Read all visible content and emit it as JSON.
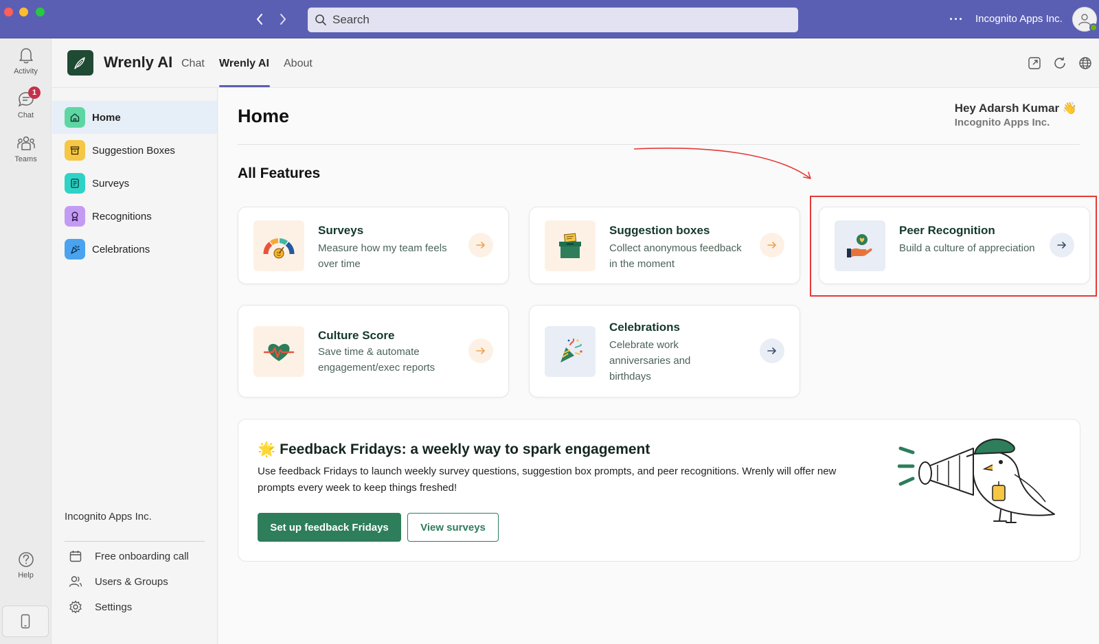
{
  "titlebar": {
    "search_placeholder": "Search",
    "org_name": "Incognito Apps Inc.",
    "more_label": "···"
  },
  "rail": {
    "items": [
      {
        "label": "Activity",
        "icon": "bell-icon"
      },
      {
        "label": "Chat",
        "icon": "chat-icon",
        "badge": "1"
      },
      {
        "label": "Teams",
        "icon": "teams-icon"
      },
      {
        "label": "Help",
        "icon": "help-icon"
      }
    ]
  },
  "app": {
    "name": "Wrenly AI",
    "tabs": [
      {
        "label": "Chat"
      },
      {
        "label": "Wrenly AI",
        "active": true
      },
      {
        "label": "About"
      }
    ]
  },
  "sidebar": {
    "items": [
      {
        "label": "Home",
        "icon": "home-icon",
        "color": "#5dd6a4",
        "active": true
      },
      {
        "label": "Suggestion Boxes",
        "icon": "box-icon",
        "color": "#f6c744"
      },
      {
        "label": "Surveys",
        "icon": "survey-icon",
        "color": "#2ed3c6"
      },
      {
        "label": "Recognitions",
        "icon": "ribbon-icon",
        "color": "#c39bf2"
      },
      {
        "label": "Celebrations",
        "icon": "party-icon",
        "color": "#4aa3ee"
      }
    ],
    "org_name": "Incognito Apps Inc.",
    "links": [
      {
        "label": "Free onboarding call",
        "icon": "calendar-icon"
      },
      {
        "label": "Users & Groups",
        "icon": "users-icon"
      },
      {
        "label": "Settings",
        "icon": "gear-icon"
      }
    ]
  },
  "main": {
    "title": "Home",
    "greeting": "Hey Adarsh Kumar 👋",
    "greeting_org": "Incognito Apps Inc.",
    "section_title": "All Features",
    "cards": [
      {
        "title": "Surveys",
        "desc": "Measure how my team feels over time",
        "thumb_color": "#fdf1e6",
        "arrow_bg": "#fdf1e6",
        "arrow_color": "#f0a24a"
      },
      {
        "title": "Suggestion boxes",
        "desc": "Collect anonymous feedback in the moment",
        "thumb_color": "#fdf1e6",
        "arrow_bg": "#fdf1e6",
        "arrow_color": "#f0a24a"
      },
      {
        "title": "Peer Recognition",
        "desc": "Build a culture of appreciation",
        "thumb_color": "#e9edf5",
        "arrow_bg": "#e9edf5",
        "arrow_color": "#3b4d6b"
      },
      {
        "title": "Culture Score",
        "desc": "Save time & automate engagement/exec reports",
        "thumb_color": "#fdf1e6",
        "arrow_bg": "#fdf1e6",
        "arrow_color": "#f0a24a"
      },
      {
        "title": "Celebrations",
        "desc": "Celebrate work anniversaries and birthdays",
        "thumb_color": "#e9edf5",
        "arrow_bg": "#e9edf5",
        "arrow_color": "#3b4d6b"
      }
    ],
    "feedback_fridays": {
      "emoji": "🌟",
      "title": "Feedback Fridays: a weekly way to spark engagement",
      "desc": "Use feedback Fridays to launch weekly survey questions, suggestion box prompts, and peer recognitions. Wrenly will offer new prompts every week to keep things freshed!",
      "primary_button": "Set up feedback Fridays",
      "secondary_button": "View surveys"
    }
  },
  "colors": {
    "titlebar": "#5b5fb3",
    "brand_green": "#2e7d5b",
    "highlight": "#e53935"
  }
}
